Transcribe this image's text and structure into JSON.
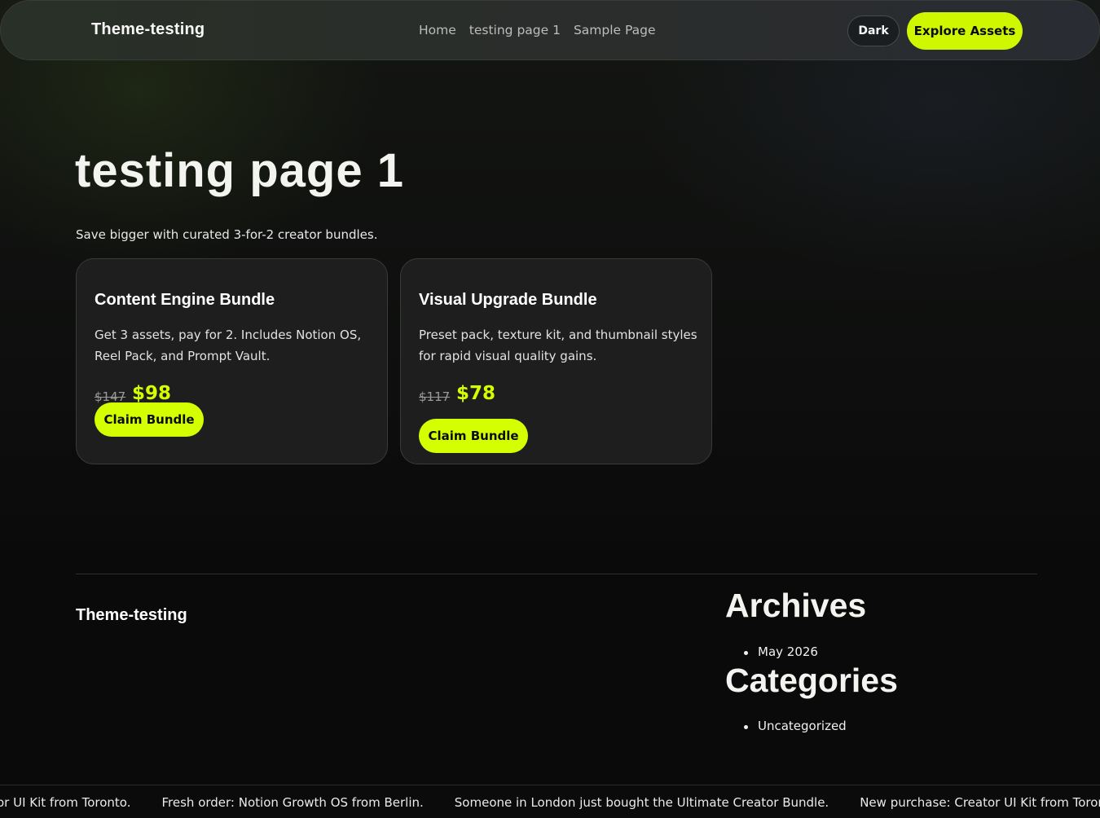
{
  "header": {
    "brand": "Theme-testing",
    "nav": [
      "Home",
      "testing page 1",
      "Sample Page"
    ],
    "theme_toggle": "Dark",
    "cta": "Explore Assets"
  },
  "main": {
    "title": "testing page 1",
    "subtitle": "Save bigger with curated 3-for-2 creator bundles.",
    "cards": [
      {
        "title": "Content Engine Bundle",
        "description": "Get 3 assets, pay for 2. Includes Notion OS, Reel Pack, and Prompt Vault.",
        "old_price": "$147",
        "price": "$98",
        "button": "Claim Bundle"
      },
      {
        "title": "Visual Upgrade Bundle",
        "description": "Preset pack, texture kit, and thumbnail styles for rapid visual quality gains.",
        "old_price": "$117",
        "price": "$78",
        "button": "Claim Bundle"
      }
    ]
  },
  "footer": {
    "brand": "Theme-testing",
    "archives_title": "Archives",
    "archives": [
      "May 2026"
    ],
    "categories_title": "Categories",
    "categories": [
      "Uncategorized"
    ]
  },
  "ticker": [
    "or UI Kit from Toronto.",
    "Fresh order: Notion Growth OS from Berlin.",
    "Someone in London just bought the Ultimate Creator Bundle.",
    "New purchase: Creator UI Kit from Toronto."
  ],
  "colors": {
    "accent": "#d4ff00",
    "background": "#0b0b0b",
    "card": "#1e1e1e"
  }
}
